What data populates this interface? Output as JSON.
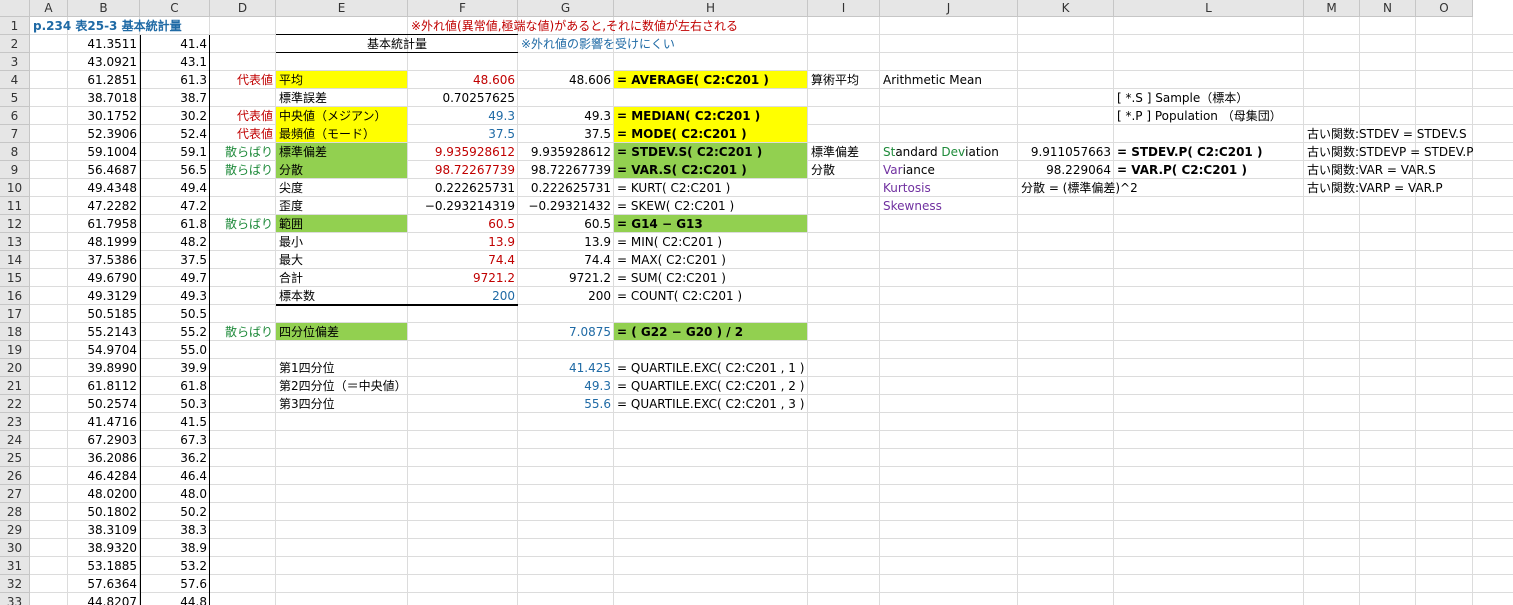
{
  "columns": [
    "A",
    "B",
    "C",
    "D",
    "E",
    "F",
    "G",
    "H",
    "I",
    "J",
    "K",
    "L",
    "M",
    "N",
    "O"
  ],
  "rows": [
    "1",
    "2",
    "3",
    "4",
    "5",
    "6",
    "7",
    "8",
    "9",
    "10",
    "11",
    "12",
    "13",
    "14",
    "15",
    "16",
    "17",
    "18",
    "19",
    "20",
    "21",
    "22",
    "23",
    "24",
    "25",
    "26",
    "27",
    "28",
    "29",
    "30",
    "31",
    "32",
    "33"
  ],
  "colors": {
    "yellow": "#ffff00",
    "green": "#92d050",
    "red": "#c00000",
    "blue": "#1f6aa5"
  },
  "cells": {
    "A1": "p.234 表25-3 基本統計量",
    "F1": "※外れ値(異常値,極端な値)があると,それに数値が左右される",
    "G2": "※外れ値の影響を受けにくい",
    "E2": "基本統計量",
    "colB": [
      "41.3511",
      "43.0921",
      "61.2851",
      "38.7018",
      "30.1752",
      "52.3906",
      "59.1004",
      "56.4687",
      "49.4348",
      "47.2282",
      "61.7958",
      "48.1999",
      "37.5386",
      "49.6790",
      "49.3129",
      "50.5185",
      "55.2143",
      "54.9704",
      "39.8990",
      "61.8112",
      "50.2574",
      "41.4716",
      "67.2903",
      "36.2086",
      "46.4284",
      "48.0200",
      "50.1802",
      "38.3109",
      "38.9320",
      "53.1885",
      "57.6364",
      "44.8207"
    ],
    "colC": [
      "41.4",
      "43.1",
      "61.3",
      "38.7",
      "30.2",
      "52.4",
      "59.1",
      "56.5",
      "49.4",
      "47.2",
      "61.8",
      "48.2",
      "37.5",
      "49.7",
      "49.3",
      "50.5",
      "55.2",
      "55.0",
      "39.9",
      "61.8",
      "50.3",
      "41.5",
      "67.3",
      "36.2",
      "46.4",
      "48.0",
      "50.2",
      "38.3",
      "38.9",
      "53.2",
      "57.6",
      "44.8"
    ],
    "D4": "代表値",
    "D6": "代表値",
    "D7": "代表値",
    "D8": "散らばり",
    "D9": "散らばり",
    "D12": "散らばり",
    "D18": "散らばり",
    "E4": "平均",
    "E5": "標準誤差",
    "E6": "中央値（メジアン）",
    "E7": "最頻値（モード）",
    "E8": "標準偏差",
    "E9": "分散",
    "E10": "尖度",
    "E11": "歪度",
    "E12": "範囲",
    "E13": "最小",
    "E14": "最大",
    "E15": "合計",
    "E16": "標本数",
    "E18": "四分位偏差",
    "E20": "第1四分位",
    "E21": "第2四分位（＝中央値）",
    "E22": "第3四分位",
    "F4": "48.606",
    "F5": "0.70257625",
    "F6": "49.3",
    "F7": "37.5",
    "F8": "9.935928612",
    "F9": "98.72267739",
    "F10": "0.222625731",
    "F11": "−0.293214319",
    "F12": "60.5",
    "F13": "13.9",
    "F14": "74.4",
    "F15": "9721.2",
    "F16": "200",
    "G4": "48.606",
    "G6": "49.3",
    "G7": "37.5",
    "G8": "9.935928612",
    "G9": "98.72267739",
    "G10": "0.222625731",
    "G11": "−0.29321432",
    "G12": "60.5",
    "G13": "13.9",
    "G14": "74.4",
    "G15": "9721.2",
    "G16": "200",
    "G18": "7.0875",
    "G20": "41.425",
    "G21": "49.3",
    "G22": "55.6",
    "H4": "= AVERAGE( C2:C201 )",
    "H6": "= MEDIAN( C2:C201 )",
    "H7": "= MODE( C2:C201 )",
    "H8": "= STDEV.S( C2:C201 )",
    "H9": "= VAR.S( C2:C201 )",
    "H10": "= KURT( C2:C201 )",
    "H11": "= SKEW( C2:C201 )",
    "H12": "= G14 − G13",
    "H13": "= MIN( C2:C201 )",
    "H14": "= MAX( C2:C201 )",
    "H15": "= SUM( C2:C201 )",
    "H16": "= COUNT( C2:C201 )",
    "H18": "= ( G22 − G20 ) / 2",
    "H20": "= QUARTILE.EXC( C2:C201 , 1 )",
    "H21": "= QUARTILE.EXC( C2:C201 , 2 )",
    "H22": "= QUARTILE.EXC( C2:C201 , 3 )",
    "I4": "算術平均",
    "I8": "標準偏差",
    "I9": "分散",
    "J4": "Arithmetic Mean",
    "J8a": "St",
    "J8b": "andard ",
    "J8c": "Dev",
    "J8d": "iation",
    "J9a": "Var",
    "J9b": "iance",
    "J10": "Kurtosis",
    "J11": "Skewness",
    "K8": "9.911057663",
    "K9": "98.229064",
    "K10": "分散 = (標準偏差)^2",
    "L5": "[ *.S ] Sample（標本）",
    "L6": "[ *.P ] Population （母集団）",
    "L8": "= STDEV.P( C2:C201 )",
    "L9": "= VAR.P( C2:C201 )",
    "M7": "古い関数:STDEV = STDEV.S",
    "M8": "古い関数:STDEVP = STDEV.P",
    "M9": "古い関数:VAR = VAR.S",
    "M10": "古い関数:VARP = VAR.P"
  }
}
